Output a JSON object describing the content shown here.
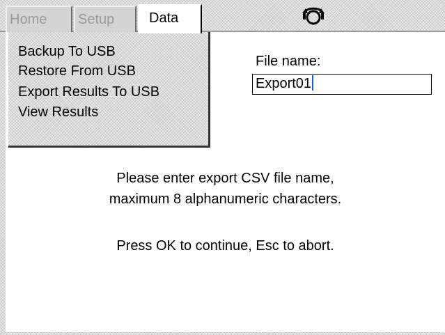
{
  "tabs": {
    "home": "Home",
    "setup": "Setup",
    "data": "Data"
  },
  "status_icon": "rotation-arrows-icon",
  "menu": {
    "items": [
      "Backup To USB",
      "Restore From USB",
      "Export Results To USB",
      "View Results"
    ]
  },
  "file": {
    "label": "File name:",
    "value": "Export01"
  },
  "message": {
    "line1": "Please enter export CSV file name,",
    "line2": "maximum 8 alphanumeric characters.",
    "line3": "Press OK to continue, Esc to abort."
  },
  "colors": {
    "background": "#ffffff",
    "frame": "#c8c8c8",
    "inactive_tab_text": "#9a9a9a",
    "caret": "#1f5fd6"
  }
}
